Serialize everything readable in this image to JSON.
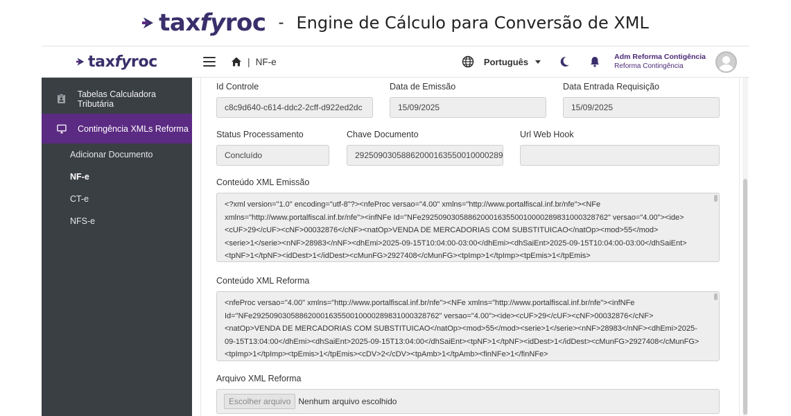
{
  "banner": {
    "logo_prefix": "tax",
    "logo_fy": "fy",
    "logo_suffix": "roc",
    "dash": "-",
    "title": "Engine de Cálculo para Conversão de XML"
  },
  "brand": {
    "primary": "#5b2a82",
    "logo_color": "#3a2f6b",
    "sidebar_bg": "#3a3f44"
  },
  "sidebar": {
    "logo_prefix": "tax",
    "logo_fy": "fy",
    "logo_suffix": "roc",
    "items": [
      {
        "label": "Tabelas Calculadora Tributária",
        "icon": "clipboard-icon"
      },
      {
        "label": "Contingência XMLs Reforma",
        "icon": "monitor-icon"
      }
    ],
    "subitems": [
      {
        "label": "Adicionar Documento"
      },
      {
        "label": "NF-e"
      },
      {
        "label": "CT-e"
      },
      {
        "label": "NFS-e"
      }
    ]
  },
  "topbar": {
    "breadcrumb_sep": "|",
    "breadcrumb": "NF-e",
    "language": "Português",
    "user_name": "Adm Reforma Contigência",
    "user_role": "Reforma Contingência"
  },
  "form": {
    "id_controle_label": "Id Controle",
    "id_controle_value": "c8c9d640-c614-ddc2-2cff-d922ed2dc",
    "data_emissao_label": "Data de Emissão",
    "data_emissao_value": "15/09/2025",
    "data_entrada_label": "Data Entrada Requisição",
    "data_entrada_value": "15/09/2025",
    "status_label": "Status Processamento",
    "status_value": "Concluído",
    "chave_label": "Chave Documento",
    "chave_value": "29250903058862000163550010000289",
    "webhook_label": "Url Web Hook",
    "webhook_value": "",
    "xml_emissao_label": "Conteúdo XML Emissão",
    "xml_emissao_value": "<?xml version=\"1.0\" encoding=\"utf-8\"?><nfeProc versao=\"4.00\" xmlns=\"http://www.portalfiscal.inf.br/nfe\"><NFe xmlns=\"http://www.portalfiscal.inf.br/nfe\"><infNFe Id=\"NFe29250903058862000163550010000289831000328762\" versao=\"4.00\"><ide><cUF>29</cUF><cNF>00032876</cNF><natOp>VENDA DE MERCADORIAS COM SUBSTITUICAO</natOp><mod>55</mod><serie>1</serie><nNF>28983</nNF><dhEmi>2025-09-15T10:04:00-03:00</dhEmi><dhSaiEnt>2025-09-15T10:04:00-03:00</dhSaiEnt><tpNF>1</tpNF><idDest>1</idDest><cMunFG>2927408</cMunFG><tpImp>1</tpImp><tpEmis>1</tpEmis>",
    "xml_reforma_label": "Conteúdo XML Reforma",
    "xml_reforma_value": "<nfeProc versao=\"4.00\" xmlns=\"http://www.portalfiscal.inf.br/nfe\"><NFe xmlns=\"http://www.portalfiscal.inf.br/nfe\"><infNFe Id=\"NFe29250903058862000163550010000289831000328762\" versao=\"4.00\"><ide><cUF>29</cUF><cNF>00032876</cNF><natOp>VENDA DE MERCADORIAS COM SUBSTITUICAO</natOp><mod>55</mod><serie>1</serie><nNF>28983</nNF><dhEmi>2025-09-15T13:04:00</dhEmi><dhSaiEnt>2025-09-15T13:04:00</dhSaiEnt><tpNF>1</tpNF><idDest>1</idDest><cMunFG>2927408</cMunFG><tpImp>1</tpImp><tpEmis>1</tpEmis><cDV>2</cDV><tpAmb>1</tpAmb><finNFe>1</finNFe>",
    "arquivo_label": "Arquivo XML Reforma",
    "arquivo_button": "Escolher arquivo",
    "arquivo_status": "Nenhum arquivo escolhido"
  }
}
